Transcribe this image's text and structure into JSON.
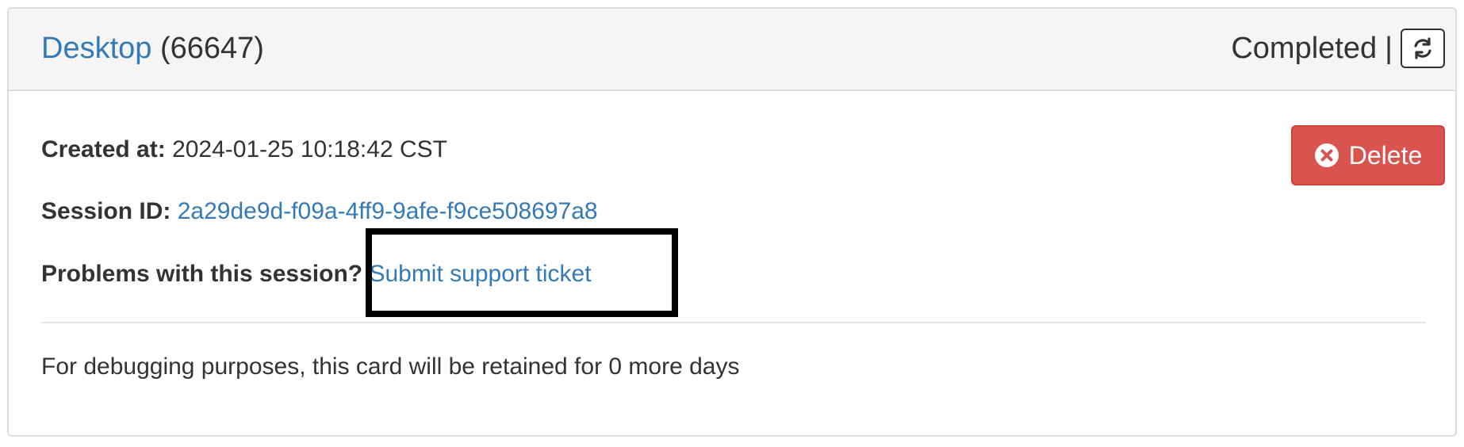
{
  "header": {
    "title_link": "Desktop",
    "id_text": "(66647)",
    "status": "Completed",
    "separator": "|",
    "refresh_icon": "refresh-icon"
  },
  "body": {
    "created_label": "Created at:",
    "created_value": "2024-01-25 10:18:42 CST",
    "session_label": "Session ID:",
    "session_value": "2a29de9d-f09a-4ff9-9afe-f9ce508697a8",
    "problems_label": "Problems with this session?",
    "support_link": "Submit support ticket",
    "retention_text": "For debugging purposes, this card will be retained for 0 more days"
  },
  "actions": {
    "delete_label": "Delete",
    "delete_icon": "times-circle-icon"
  },
  "colors": {
    "link": "#337ab7",
    "danger": "#d9534f",
    "header_bg": "#f5f5f5",
    "highlight": "#000000"
  }
}
